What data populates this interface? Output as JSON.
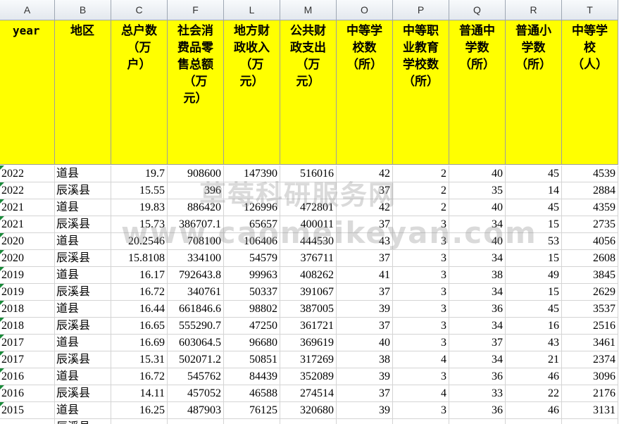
{
  "column_letters": [
    "A",
    "B",
    "C",
    "F",
    "L",
    "M",
    "O",
    "P",
    "Q",
    "R",
    "T"
  ],
  "header": [
    "year",
    "地区",
    "总户数\n（万\n户）",
    "社会消\n费品零\n售总额\n（万\n元）",
    "地方财\n政收入\n（万\n元）",
    "公共财\n政支出\n（万\n元）",
    "中等学\n校数\n（所）",
    "中等职\n业教育\n学校数\n（所）",
    "普通中\n学数\n（所）",
    "普通小\n学数\n（所）",
    "中等学\n校\n（人）"
  ],
  "rows": [
    [
      "2022",
      "道县",
      "19.7",
      "908600",
      "147390",
      "516016",
      "42",
      "2",
      "40",
      "45",
      "4539"
    ],
    [
      "2022",
      "辰溪县",
      "15.55",
      "396",
      "",
      "",
      "37",
      "2",
      "35",
      "14",
      "2884"
    ],
    [
      "2021",
      "道县",
      "19.83",
      "886420",
      "126996",
      "472801",
      "42",
      "2",
      "40",
      "45",
      "4359"
    ],
    [
      "2021",
      "辰溪县",
      "15.73",
      "386707.1",
      "65657",
      "400011",
      "37",
      "3",
      "34",
      "15",
      "2735"
    ],
    [
      "2020",
      "道县",
      "20.2546",
      "708100",
      "106406",
      "444530",
      "43",
      "3",
      "40",
      "53",
      "4056"
    ],
    [
      "2020",
      "辰溪县",
      "15.8108",
      "334100",
      "54579",
      "376711",
      "37",
      "3",
      "34",
      "15",
      "2608"
    ],
    [
      "2019",
      "道县",
      "16.17",
      "792643.8",
      "99963",
      "408262",
      "41",
      "3",
      "38",
      "49",
      "3845"
    ],
    [
      "2019",
      "辰溪县",
      "16.72",
      "340761",
      "50337",
      "391067",
      "37",
      "3",
      "34",
      "15",
      "2629"
    ],
    [
      "2018",
      "道县",
      "16.44",
      "661846.6",
      "98802",
      "387005",
      "39",
      "3",
      "36",
      "45",
      "3537"
    ],
    [
      "2018",
      "辰溪县",
      "16.65",
      "555290.7",
      "47250",
      "361721",
      "37",
      "3",
      "34",
      "16",
      "2516"
    ],
    [
      "2017",
      "道县",
      "16.69",
      "603064.5",
      "96680",
      "369619",
      "40",
      "3",
      "37",
      "43",
      "3461"
    ],
    [
      "2017",
      "辰溪县",
      "15.31",
      "502071.2",
      "50851",
      "317269",
      "38",
      "4",
      "34",
      "21",
      "2374"
    ],
    [
      "2016",
      "道县",
      "16.72",
      "545762",
      "84439",
      "352089",
      "39",
      "3",
      "36",
      "46",
      "3096"
    ],
    [
      "2016",
      "辰溪县",
      "14.11",
      "457052",
      "46588",
      "274514",
      "37",
      "4",
      "33",
      "22",
      "2176"
    ],
    [
      "2015",
      "道县",
      "16.25",
      "487903",
      "76125",
      "320680",
      "39",
      "3",
      "36",
      "46",
      "3131"
    ],
    [
      "",
      "辰溪县",
      "",
      "",
      "",
      "",
      "",
      "",
      "",
      "",
      ""
    ]
  ],
  "watermark": {
    "line1": "草莓科研服务网",
    "line2": "www.caomeikeyan.com"
  }
}
